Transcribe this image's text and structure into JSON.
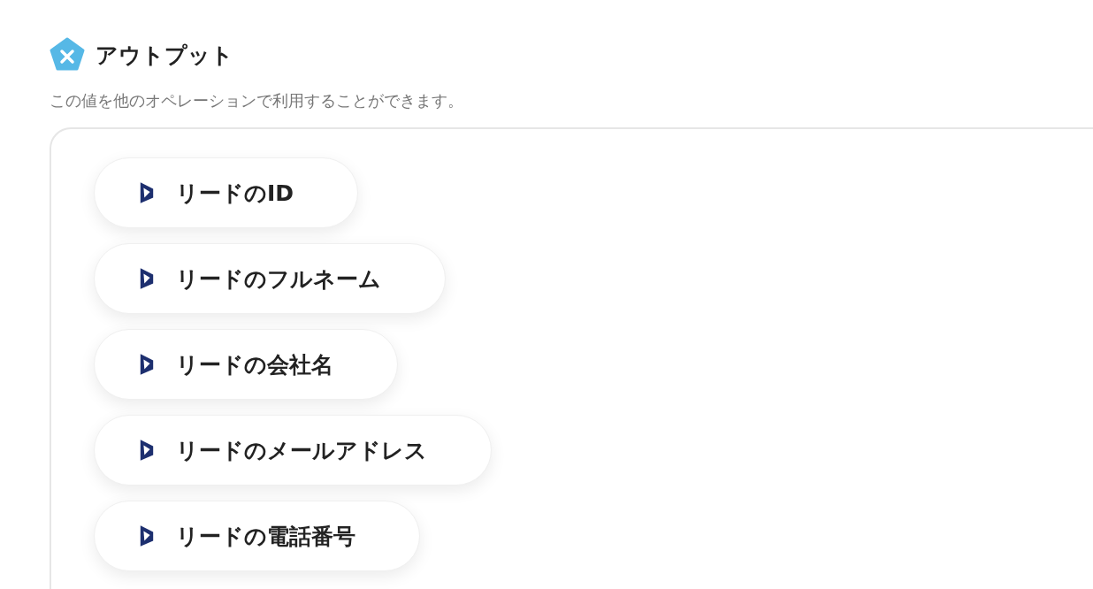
{
  "section": {
    "title": "アウトプット",
    "description": "この値を他のオペレーションで利用することができます。"
  },
  "outputs": [
    {
      "label": "リードのID"
    },
    {
      "label": "リードのフルネーム"
    },
    {
      "label": "リードの会社名"
    },
    {
      "label": "リードのメールアドレス"
    },
    {
      "label": "リードの電話番号"
    }
  ]
}
